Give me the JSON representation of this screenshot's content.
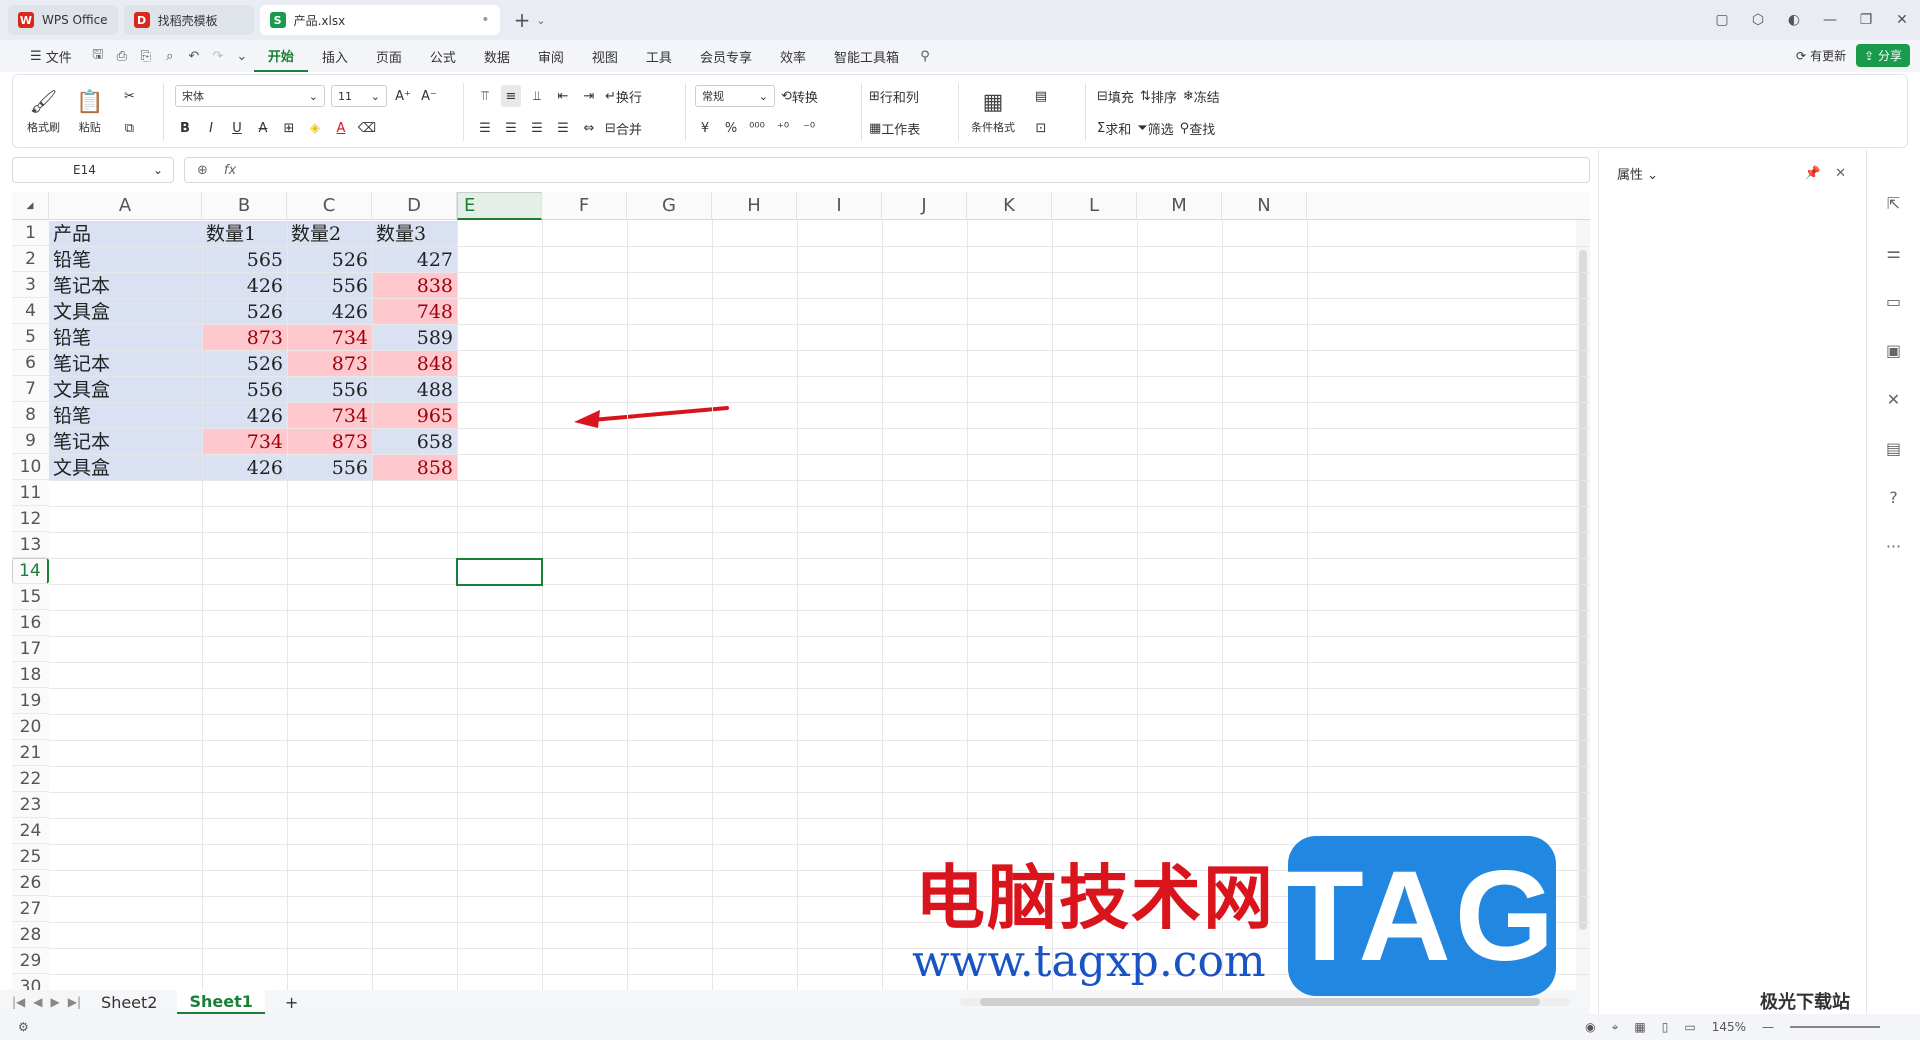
{
  "tabs": [
    {
      "label": "WPS Office",
      "badge": "W",
      "color": "#d9291c"
    },
    {
      "label": "找稻壳模板",
      "badge": "D",
      "color": "#d9291c"
    },
    {
      "label": "产品.xlsx",
      "badge": "S",
      "color": "#1a9b4b"
    }
  ],
  "menu": {
    "file": "文件",
    "items": [
      "开始",
      "插入",
      "页面",
      "公式",
      "数据",
      "审阅",
      "视图",
      "工具",
      "会员专享",
      "效率",
      "智能工具箱"
    ],
    "active": "开始",
    "update": "有更新",
    "share": "分享"
  },
  "ribbon": {
    "format_painter": "格式刷",
    "paste": "粘贴",
    "font": "宋体",
    "size": "11",
    "wrap": "换行",
    "merge": "合并",
    "numfmt": "常规",
    "convert": "转换",
    "rowcol": "行和列",
    "sheet": "工作表",
    "cond": "条件格式",
    "fill": "填充",
    "sort": "排序",
    "freeze": "冻结",
    "sum": "求和",
    "filter": "筛选",
    "find": "查找"
  },
  "formula": {
    "cell": "E14",
    "fx": "fx",
    "value": ""
  },
  "columns": [
    "A",
    "B",
    "C",
    "D",
    "E",
    "F",
    "G",
    "H",
    "I",
    "J",
    "K",
    "L",
    "M",
    "N"
  ],
  "selected_col": "E",
  "selected_row": "14",
  "rows": [
    "1",
    "2",
    "3",
    "4",
    "5",
    "6",
    "7",
    "8",
    "9",
    "10",
    "11",
    "12",
    "13",
    "14",
    "15",
    "16",
    "17",
    "18",
    "19",
    "20",
    "21",
    "22",
    "23",
    "24",
    "25",
    "26",
    "27",
    "28",
    "29",
    "30"
  ],
  "table": {
    "header": [
      "产品",
      "数量1",
      "数量2",
      "数量3"
    ],
    "data": [
      [
        "铅笔",
        "565",
        "526",
        "427"
      ],
      [
        "笔记本",
        "426",
        "556",
        "838"
      ],
      [
        "文具盒",
        "526",
        "426",
        "748"
      ],
      [
        "铅笔",
        "873",
        "734",
        "589"
      ],
      [
        "笔记本",
        "526",
        "873",
        "848"
      ],
      [
        "文具盒",
        "556",
        "556",
        "488"
      ],
      [
        "铅笔",
        "426",
        "734",
        "965"
      ],
      [
        "笔记本",
        "734",
        "873",
        "658"
      ],
      [
        "文具盒",
        "426",
        "556",
        "858"
      ]
    ],
    "highlight": [
      [
        false,
        false,
        false
      ],
      [
        false,
        false,
        true
      ],
      [
        false,
        false,
        true
      ],
      [
        true,
        true,
        false
      ],
      [
        false,
        true,
        true
      ],
      [
        false,
        false,
        false
      ],
      [
        false,
        true,
        true
      ],
      [
        true,
        true,
        false
      ],
      [
        false,
        false,
        true
      ]
    ],
    "base_fill": "#d9e1f2",
    "highlight_fill": "#ffc7ce",
    "highlight_text": "#9c0006"
  },
  "sheets": [
    "Sheet2",
    "Sheet1"
  ],
  "active_sheet": "Sheet1",
  "side_panel": {
    "title": "属性"
  },
  "status": {
    "zoom": "145%"
  },
  "watermark": {
    "title": "电脑技术网",
    "url": "www.tagxp.com",
    "tag": "TAG",
    "site": "极光下载站"
  }
}
